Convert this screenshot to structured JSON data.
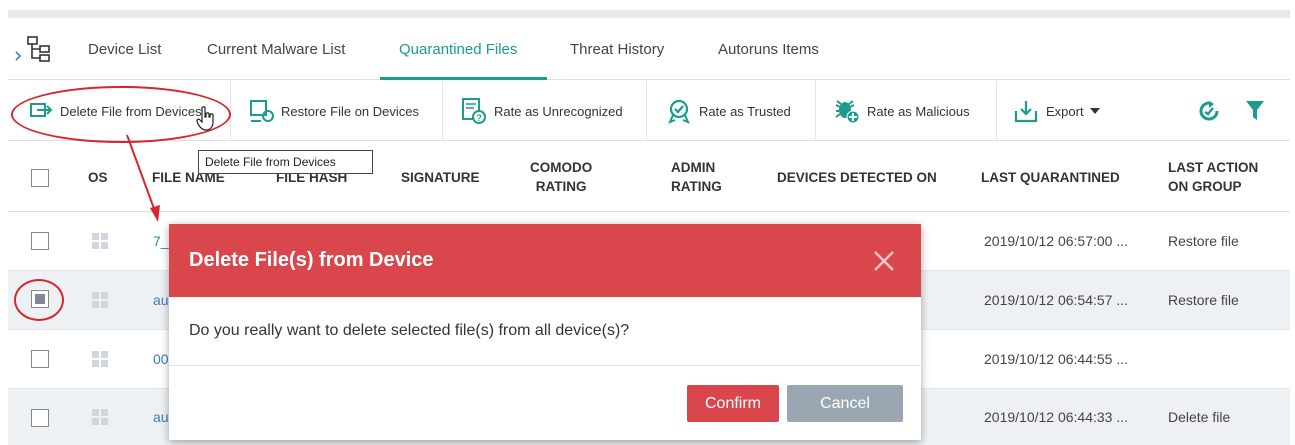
{
  "tabs": [
    {
      "label": "Device List"
    },
    {
      "label": "Current Malware List"
    },
    {
      "label": "Quarantined Files"
    },
    {
      "label": "Threat History"
    },
    {
      "label": "Autoruns Items"
    }
  ],
  "toolbar": {
    "delete": "Delete File from Devices",
    "restore": "Restore File on Devices",
    "unrecognized": "Rate as Unrecognized",
    "trusted": "Rate as Trusted",
    "malicious": "Rate as Malicious",
    "export": "Export"
  },
  "tooltip": "Delete File from Devices",
  "columns": {
    "os": "OS",
    "file_name": "FILE NAME",
    "file_hash": "FILE HASH",
    "signature": "SIGNATURE",
    "comodo_rating_1": "COMODO",
    "comodo_rating_2": "RATING",
    "admin_rating_1": "ADMIN",
    "admin_rating_2": "RATING",
    "devices_detected": "DEVICES DETECTED ON",
    "last_quarantined": "LAST QUARANTINED",
    "last_action_1": "LAST ACTION",
    "last_action_2": "ON GROUP"
  },
  "rows": [
    {
      "file_name": "7_",
      "last_quarantined": "2019/10/12 06:57:00 ...",
      "last_action": "Restore file",
      "checked": false
    },
    {
      "file_name": "au",
      "last_quarantined": "2019/10/12 06:54:57 ...",
      "last_action": "Restore file",
      "checked": true
    },
    {
      "file_name": "00",
      "last_quarantined": "2019/10/12 06:44:55 ...",
      "last_action": "",
      "checked": false
    },
    {
      "file_name": "au",
      "last_quarantined": "2019/10/12 06:44:33 ...",
      "last_action": "Delete file",
      "checked": false
    }
  ],
  "modal": {
    "title": "Delete File(s) from Device",
    "message": "Do you really want to delete selected file(s) from all device(s)?",
    "confirm": "Confirm",
    "cancel": "Cancel"
  },
  "colors": {
    "accent": "#1a9c8e",
    "danger": "#d9474d",
    "annotation": "#d8262e",
    "muted_button": "#9aa6b2"
  },
  "icons": [
    "tree-icon",
    "delete-file-icon",
    "restore-file-icon",
    "unrecognized-icon",
    "trusted-icon",
    "malicious-icon",
    "export-icon",
    "refresh-icon",
    "filter-icon",
    "windows-icon",
    "close-icon",
    "cursor-icon"
  ]
}
